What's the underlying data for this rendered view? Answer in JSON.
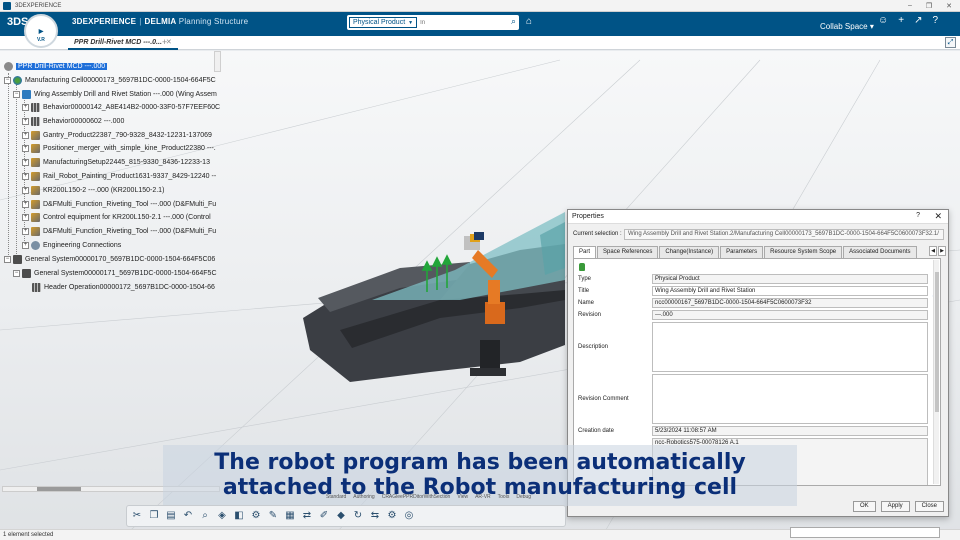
{
  "window": {
    "app_name": "3DEXPERIENCE",
    "controls": [
      "–",
      "❐",
      "✕"
    ]
  },
  "topbar": {
    "logo": "3DS",
    "brand_bold": "3DEXPERIENCE",
    "brand_sep": "|",
    "brand_product": "DELMIA",
    "brand_app": "Planning Structure",
    "compass_version": "V.R",
    "search_scope": "Physical Product",
    "search_placeholder": "In",
    "collab_space": "Collab Space",
    "accent": "#005386"
  },
  "tabbar": {
    "active_tab": "PPR Drill-Rivet MCD ---.0...",
    "close": "✕",
    "add": "+"
  },
  "tree": {
    "items": [
      {
        "label": "PPR Drill-Rivet MCD ---.000"
      },
      {
        "label": "Manufacturing Cell00000173_5697B1DC-0000-1504-664F5C"
      },
      {
        "label": "Wing Assembly Drill and Rivet Station ---.000 (Wing Assem"
      },
      {
        "label": "Behavior00000142_A8E414B2-0000-33F0-57F7EEF60C"
      },
      {
        "label": "Behavior00000602 ---.000"
      },
      {
        "label": "Gantry_Product22387_790-9328_8432-12231-137069"
      },
      {
        "label": "Positioner_merger_with_simple_kine_Product22380 ---."
      },
      {
        "label": "ManufacturingSetup22445_815-9330_8436-12233-13"
      },
      {
        "label": "Rail_Robot_Painting_Product1631-9337_8429-12240 --"
      },
      {
        "label": "KR200L150-2 ---.000 (KR200L150-2.1)"
      },
      {
        "label": "D&FMulti_Function_Riveting_Tool ---.000 (D&FMulti_Fu"
      },
      {
        "label": "Control equipment for KR200L150-2.1 ---.000 (Control"
      },
      {
        "label": "D&FMulti_Function_Riveting_Tool ---.000 (D&FMulti_Fu"
      },
      {
        "label": "Engineering Connections"
      },
      {
        "label": "General System00000170_5697B1DC-0000-1504-664F5C06"
      },
      {
        "label": "General System00000171_5697B1DC-0000-1504-664F5C"
      },
      {
        "label": "Header Operation00000172_5697B1DC-0000-1504-66"
      }
    ]
  },
  "properties": {
    "title": "Properties",
    "help": "?",
    "close": "✕",
    "current_selection_label": "Current selection :",
    "current_selection": "Wing Assembly Drill and Rivet Station.2/Manufacturing Cell00000173_5697B1DC-0000-1504-664F5C0600073F32.1/",
    "tabs": [
      "Part",
      "Space References",
      "Change(Instance)",
      "Parameters",
      "Resource System Scope",
      "Associated Documents"
    ],
    "fields": {
      "type_label": "Type",
      "type": "Physical Product",
      "title_label": "Title",
      "title": "Wing Assembly Drill and Rivet Station",
      "name_label": "Name",
      "name": "ncc00000167_5697B1DC-0000-1504-664F5C0600073F32",
      "revision_label": "Revision",
      "revision": "---.000",
      "description_label": "Description",
      "description": "",
      "revision_comment_label": "Revision Comment",
      "revision_comment": "",
      "creation_date_label": "Creation date",
      "creation_date": "5/23/2024 11:08:57 AM",
      "extra_value": "ncc-Robotics575-00078126 A.1"
    },
    "buttons": {
      "ok": "OK",
      "apply": "Apply",
      "close": "Close"
    }
  },
  "toolbar": {
    "sections": [
      "Standard",
      "Authoring",
      "CRAGleePPRDitorWithSection",
      "View",
      "AR-VR",
      "Tools",
      "Debug"
    ]
  },
  "status": {
    "text": "1 element selected"
  },
  "caption": {
    "line1": "The robot program has been automatically",
    "line2": "attached to the Robot manufacturing cell"
  }
}
